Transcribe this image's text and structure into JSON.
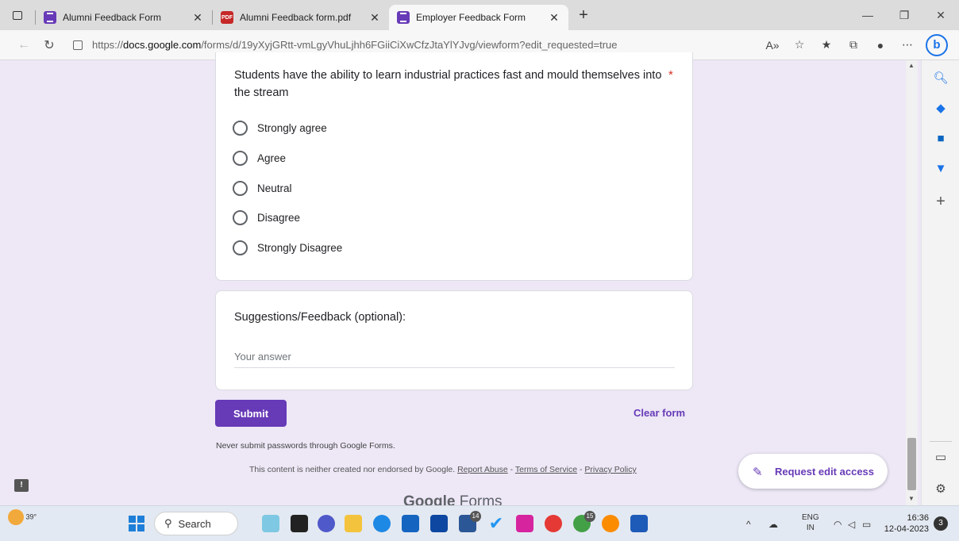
{
  "browser": {
    "tabs": [
      {
        "title": "Alumni Feedback Form",
        "icon": "forms-icon"
      },
      {
        "title": "Alumni Feedback form.pdf",
        "icon": "pdf-icon"
      },
      {
        "title": "Employer Feedback Form",
        "icon": "forms-icon",
        "active": true
      }
    ],
    "new_tab": "+",
    "address": {
      "prefix": "https://",
      "domain": "docs.google.com",
      "path": "/forms/d/19yXyjGRtt-vmLgyVhuLjhh6FGiiCiXwCfzJtaYlYJvg/viewform?edit_requested=true"
    },
    "copilot_label": "b"
  },
  "question": {
    "text": "Students have the ability to learn industrial practices fast and mould themselves into the stream",
    "required_mark": "*",
    "options": [
      "Strongly agree",
      "Agree",
      "Neutral",
      "Disagree",
      "Strongly Disagree"
    ]
  },
  "suggestions": {
    "title": "Suggestions/Feedback (optional):",
    "placeholder": "Your answer"
  },
  "actions": {
    "submit": "Submit",
    "clear": "Clear form"
  },
  "footer": {
    "warning": "Never submit passwords through Google Forms.",
    "disclaimer": "This content is neither created nor endorsed by Google.",
    "report_abuse": "Report Abuse",
    "sep": " - ",
    "terms": "Terms of Service",
    "privacy": "Privacy Policy",
    "brand_google": "Google",
    "brand_forms": "Forms"
  },
  "request_edit": "Request edit access",
  "taskbar": {
    "weather_temp": "39°",
    "search_label": "Search",
    "badges": {
      "app14": "14",
      "app15": "15"
    },
    "lang_top": "ENG",
    "lang_bottom": "IN",
    "time": "16:36",
    "date": "12-04-2023",
    "notifications": "3"
  },
  "colors": {
    "accent": "#673ab7",
    "background": "#ede7f6",
    "required": "#d93025"
  }
}
